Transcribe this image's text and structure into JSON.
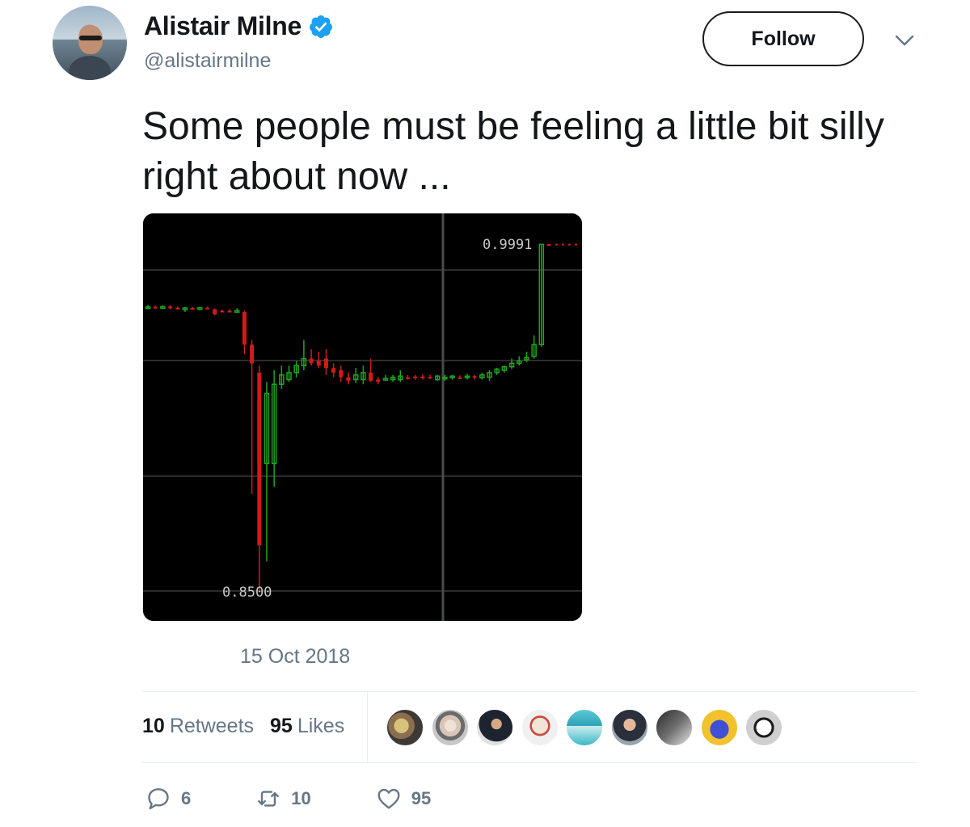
{
  "user": {
    "display_name": "Alistair Milne",
    "handle": "@alistairmilne",
    "verified": true
  },
  "header": {
    "follow_label": "Follow"
  },
  "tweet": {
    "text": "Some people must be feeling a little bit silly right about now ...",
    "timestamp": "15 Oct 2018"
  },
  "chart_data": {
    "type": "candlestick",
    "annotations": [
      "0.9991",
      "0.8500"
    ],
    "high_label": "0.9991",
    "low_label": "0.8500",
    "ylim": [
      0.85,
      0.9991
    ],
    "candles": [
      {
        "o": 0.972,
        "c": 0.9722,
        "h": 0.973,
        "l": 0.9712,
        "dir": "up"
      },
      {
        "o": 0.9722,
        "c": 0.9721,
        "h": 0.9728,
        "l": 0.9715,
        "dir": "down"
      },
      {
        "o": 0.9721,
        "c": 0.9723,
        "h": 0.9729,
        "l": 0.9714,
        "dir": "up"
      },
      {
        "o": 0.9723,
        "c": 0.9718,
        "h": 0.973,
        "l": 0.9712,
        "dir": "down"
      },
      {
        "o": 0.9718,
        "c": 0.9716,
        "h": 0.9724,
        "l": 0.971,
        "dir": "down"
      },
      {
        "o": 0.9716,
        "c": 0.9717,
        "h": 0.9722,
        "l": 0.97,
        "dir": "up"
      },
      {
        "o": 0.9717,
        "c": 0.9715,
        "h": 0.9722,
        "l": 0.9709,
        "dir": "down"
      },
      {
        "o": 0.9715,
        "c": 0.9718,
        "h": 0.9722,
        "l": 0.971,
        "dir": "up"
      },
      {
        "o": 0.9718,
        "c": 0.9716,
        "h": 0.9723,
        "l": 0.9712,
        "dir": "down"
      },
      {
        "o": 0.9712,
        "c": 0.969,
        "h": 0.9715,
        "l": 0.9685,
        "dir": "down"
      },
      {
        "o": 0.9705,
        "c": 0.9703,
        "h": 0.971,
        "l": 0.97,
        "dir": "down"
      },
      {
        "o": 0.9705,
        "c": 0.9704,
        "h": 0.9712,
        "l": 0.97,
        "dir": "down"
      },
      {
        "o": 0.9706,
        "c": 0.9704,
        "h": 0.9716,
        "l": 0.9697,
        "dir": "up"
      },
      {
        "o": 0.97,
        "c": 0.956,
        "h": 0.9705,
        "l": 0.952,
        "dir": "down"
      },
      {
        "o": 0.956,
        "c": 0.948,
        "h": 0.958,
        "l": 0.892,
        "dir": "down"
      },
      {
        "o": 0.944,
        "c": 0.87,
        "h": 0.947,
        "l": 0.85,
        "dir": "down"
      },
      {
        "o": 0.905,
        "c": 0.935,
        "h": 0.94,
        "l": 0.863,
        "dir": "up"
      },
      {
        "o": 0.905,
        "c": 0.939,
        "h": 0.945,
        "l": 0.895,
        "dir": "up"
      },
      {
        "o": 0.939,
        "c": 0.943,
        "h": 0.947,
        "l": 0.937,
        "dir": "up"
      },
      {
        "o": 0.941,
        "c": 0.944,
        "h": 0.947,
        "l": 0.94,
        "dir": "up"
      },
      {
        "o": 0.944,
        "c": 0.947,
        "h": 0.949,
        "l": 0.942,
        "dir": "up"
      },
      {
        "o": 0.947,
        "c": 0.95,
        "h": 0.958,
        "l": 0.945,
        "dir": "up"
      },
      {
        "o": 0.95,
        "c": 0.948,
        "h": 0.954,
        "l": 0.947,
        "dir": "down"
      },
      {
        "o": 0.949,
        "c": 0.947,
        "h": 0.953,
        "l": 0.946,
        "dir": "down"
      },
      {
        "o": 0.95,
        "c": 0.946,
        "h": 0.954,
        "l": 0.943,
        "dir": "down"
      },
      {
        "o": 0.946,
        "c": 0.944,
        "h": 0.948,
        "l": 0.942,
        "dir": "down"
      },
      {
        "o": 0.945,
        "c": 0.942,
        "h": 0.947,
        "l": 0.94,
        "dir": "down"
      },
      {
        "o": 0.942,
        "c": 0.9405,
        "h": 0.944,
        "l": 0.939,
        "dir": "down"
      },
      {
        "o": 0.941,
        "c": 0.943,
        "h": 0.946,
        "l": 0.9395,
        "dir": "up"
      },
      {
        "o": 0.941,
        "c": 0.944,
        "h": 0.947,
        "l": 0.939,
        "dir": "up"
      },
      {
        "o": 0.944,
        "c": 0.9405,
        "h": 0.95,
        "l": 0.94,
        "dir": "down"
      },
      {
        "o": 0.941,
        "c": 0.94,
        "h": 0.942,
        "l": 0.939,
        "dir": "down"
      },
      {
        "o": 0.941,
        "c": 0.9415,
        "h": 0.943,
        "l": 0.9405,
        "dir": "up"
      },
      {
        "o": 0.941,
        "c": 0.942,
        "h": 0.943,
        "l": 0.94,
        "dir": "up"
      },
      {
        "o": 0.941,
        "c": 0.9425,
        "h": 0.945,
        "l": 0.94,
        "dir": "up"
      },
      {
        "o": 0.942,
        "c": 0.942,
        "h": 0.943,
        "l": 0.941,
        "dir": "down"
      },
      {
        "o": 0.9423,
        "c": 0.942,
        "h": 0.943,
        "l": 0.941,
        "dir": "down"
      },
      {
        "o": 0.9423,
        "c": 0.9418,
        "h": 0.9432,
        "l": 0.941,
        "dir": "down"
      },
      {
        "o": 0.9422,
        "c": 0.9421,
        "h": 0.943,
        "l": 0.9412,
        "dir": "down"
      },
      {
        "o": 0.941,
        "c": 0.9425,
        "h": 0.943,
        "l": 0.9405,
        "dir": "up"
      },
      {
        "o": 0.9415,
        "c": 0.942,
        "h": 0.943,
        "l": 0.9405,
        "dir": "up"
      },
      {
        "o": 0.942,
        "c": 0.9425,
        "h": 0.943,
        "l": 0.941,
        "dir": "up"
      },
      {
        "o": 0.942,
        "c": 0.9418,
        "h": 0.9428,
        "l": 0.9412,
        "dir": "down"
      },
      {
        "o": 0.9418,
        "c": 0.9425,
        "h": 0.9435,
        "l": 0.941,
        "dir": "up"
      },
      {
        "o": 0.9425,
        "c": 0.9418,
        "h": 0.943,
        "l": 0.941,
        "dir": "down"
      },
      {
        "o": 0.9418,
        "c": 0.943,
        "h": 0.944,
        "l": 0.941,
        "dir": "up"
      },
      {
        "o": 0.942,
        "c": 0.944,
        "h": 0.945,
        "l": 0.9405,
        "dir": "up"
      },
      {
        "o": 0.944,
        "c": 0.9455,
        "h": 0.946,
        "l": 0.943,
        "dir": "up"
      },
      {
        "o": 0.945,
        "c": 0.9465,
        "h": 0.947,
        "l": 0.944,
        "dir": "up"
      },
      {
        "o": 0.9465,
        "c": 0.948,
        "h": 0.95,
        "l": 0.9455,
        "dir": "up"
      },
      {
        "o": 0.948,
        "c": 0.949,
        "h": 0.951,
        "l": 0.947,
        "dir": "up"
      },
      {
        "o": 0.9495,
        "c": 0.9505,
        "h": 0.953,
        "l": 0.9485,
        "dir": "up"
      },
      {
        "o": 0.951,
        "c": 0.956,
        "h": 0.96,
        "l": 0.95,
        "dir": "up"
      },
      {
        "o": 0.956,
        "c": 0.999,
        "h": 0.9991,
        "l": 0.955,
        "dir": "up"
      },
      {
        "o": 0.9991,
        "c": 0.9989,
        "h": 0.9991,
        "l": 0.9985,
        "dir": "down"
      }
    ]
  },
  "engagement": {
    "retweets_count": "10",
    "retweets_label": "Retweets",
    "likes_count": "95",
    "likes_label": "Likes"
  },
  "likers": [
    {
      "name": "liker-avatar-1"
    },
    {
      "name": "liker-avatar-2"
    },
    {
      "name": "liker-avatar-3"
    },
    {
      "name": "liker-avatar-4"
    },
    {
      "name": "liker-avatar-5"
    },
    {
      "name": "liker-avatar-6"
    },
    {
      "name": "liker-avatar-7"
    },
    {
      "name": "liker-avatar-8"
    },
    {
      "name": "liker-avatar-9"
    }
  ],
  "actions": {
    "reply_count": "6",
    "retweet_count": "10",
    "like_count": "95"
  },
  "colors": {
    "verified": "#1da1f2",
    "muted": "#657786",
    "up_candle": "#1fa31f",
    "down_candle": "#d11a1a"
  }
}
